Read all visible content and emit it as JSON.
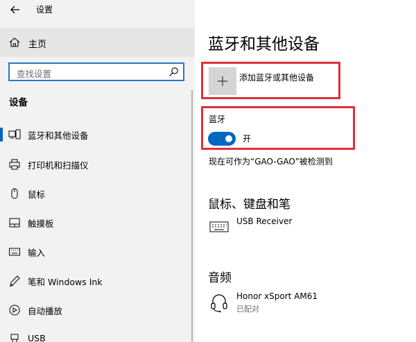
{
  "window": {
    "title": "设置"
  },
  "sidebar": {
    "home_label": "主页",
    "search_placeholder": "查找设置",
    "section_title": "设备",
    "items": [
      {
        "label": "蓝牙和其他设备",
        "icon": "bluetooth-devices-icon",
        "selected": true
      },
      {
        "label": "打印机和扫描仪",
        "icon": "printer-icon"
      },
      {
        "label": "鼠标",
        "icon": "mouse-icon"
      },
      {
        "label": "触摸板",
        "icon": "touchpad-icon"
      },
      {
        "label": "输入",
        "icon": "keyboard-icon"
      },
      {
        "label": "笔和 Windows Ink",
        "icon": "pen-icon"
      },
      {
        "label": "自动播放",
        "icon": "autoplay-icon"
      },
      {
        "label": "USB",
        "icon": "usb-icon"
      }
    ]
  },
  "main": {
    "title": "蓝牙和其他设备",
    "add_device_label": "添加蓝牙或其他设备",
    "bluetooth": {
      "label": "蓝牙",
      "state": "开",
      "on": true,
      "discoverable_text": "现在可作为“GAO-GAO”被检测到"
    },
    "mouse_section": {
      "title": "鼠标、键盘和笔",
      "devices": [
        {
          "name": "USB Receiver",
          "icon": "keyboard-icon"
        }
      ]
    },
    "audio_section": {
      "title": "音频",
      "devices": [
        {
          "name": "Honor xSport AM61",
          "status": "已配对",
          "icon": "headset-icon"
        }
      ]
    }
  },
  "colors": {
    "accent": "#0067c0",
    "highlight": "#e12f3a",
    "sidebar_bg": "#f2f2f2"
  }
}
